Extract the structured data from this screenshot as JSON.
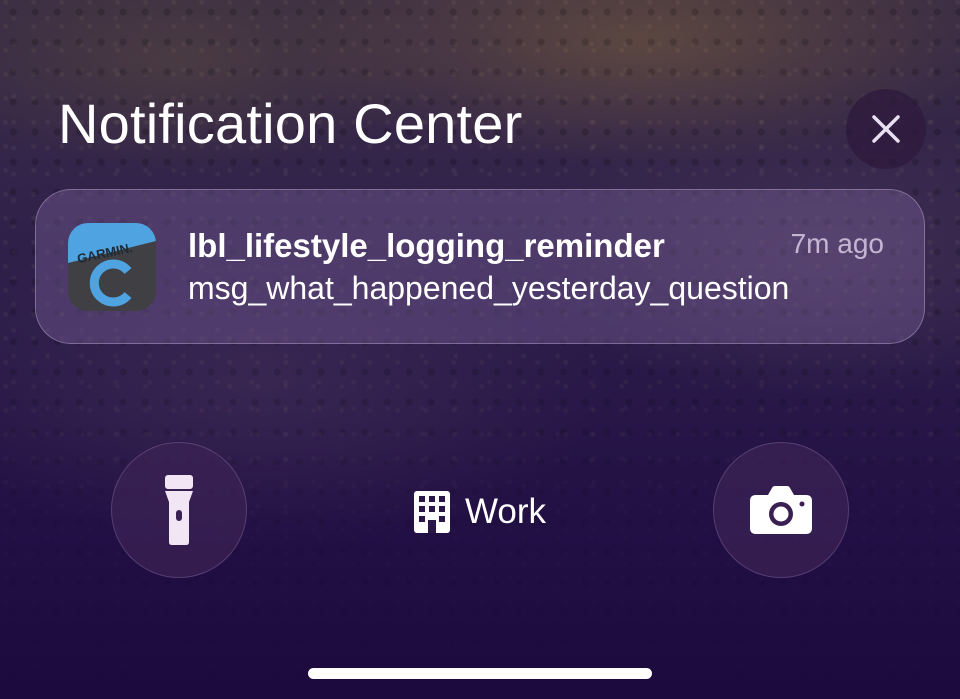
{
  "notification_center": {
    "title": "Notification Center"
  },
  "notification": {
    "app_name": "GARMIN.",
    "title": "lbl_lifestyle_logging_reminder",
    "time": "7m ago",
    "body": "msg_what_happened_yesterday_question"
  },
  "focus": {
    "label": "Work",
    "icon": "building-icon"
  },
  "quick_actions": {
    "left_icon": "flashlight-icon",
    "right_icon": "camera-icon"
  },
  "colors": {
    "garmin_blue": "#4fa3e0",
    "garmin_gray": "#3f3f44",
    "accent_white": "#ffffff"
  }
}
